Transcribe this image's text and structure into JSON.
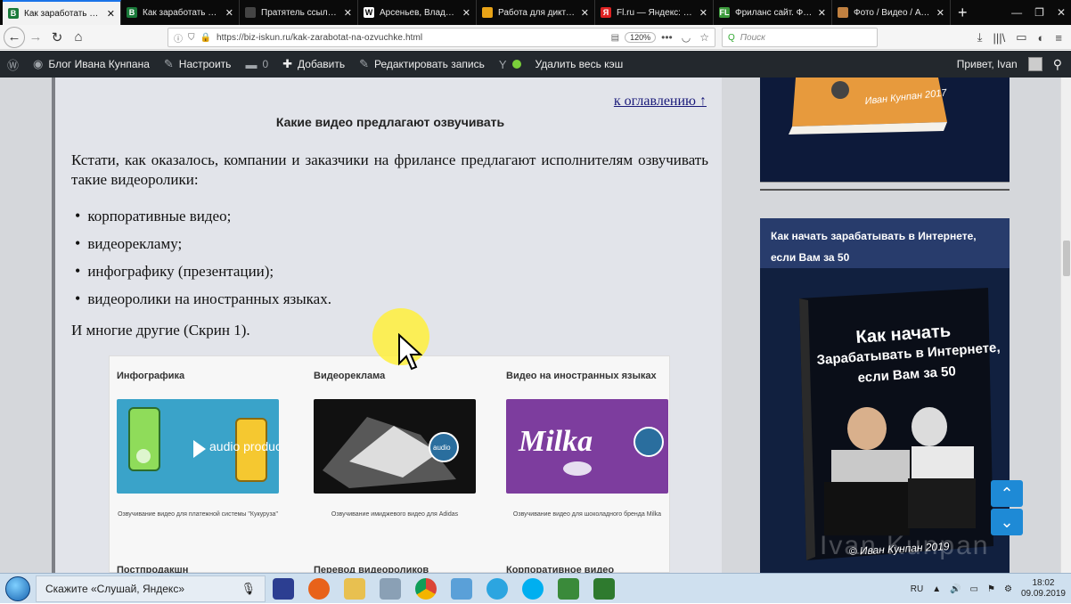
{
  "browser": {
    "tabs": [
      {
        "label": "Как заработать на оз",
        "favicon_color": "#1a7a3a",
        "favicon": "B",
        "active": true
      },
      {
        "label": "Как заработать день",
        "favicon_color": "#1a7a3a",
        "favicon": "B",
        "active": false
      },
      {
        "label": "Пратятель ссылок PRO",
        "favicon_color": "#444",
        "favicon": "",
        "active": false
      },
      {
        "label": "Арсеньев, Владимир",
        "favicon_color": "#fff",
        "favicon": "W",
        "active": false
      },
      {
        "label": "Работа для диктора",
        "favicon_color": "#e8a317",
        "favicon": "",
        "active": false
      },
      {
        "label": "Fl.ru — Яндекс: наш",
        "favicon_color": "#d22",
        "favicon": "Я",
        "active": false
      },
      {
        "label": "Фриланс сайт. Фри",
        "favicon_color": "#3c9a3c",
        "favicon": "FL",
        "active": false
      },
      {
        "label": "Фото / Видео / Ауди",
        "favicon_color": "#c08040",
        "favicon": "",
        "active": false
      }
    ],
    "url": "https://biz-iskun.ru/kak-zarabotat-na-ozvuchke.html",
    "zoom": "120%",
    "search_placeholder": "Поиск"
  },
  "wpbar": {
    "site_name": "Блог Ивана Кунпана",
    "customize": "Настроить",
    "comments": "0",
    "add_new": "Добавить",
    "edit_post": "Редактировать запись",
    "clear_cache": "Удалить весь кэш",
    "greeting": "Привет, Ivan"
  },
  "article": {
    "toc_link": "к оглавлению ↑",
    "heading": "Какие видео предлагают озвучивать",
    "intro": "Кстати, как оказалось, компании и заказчики на фрилансе предлагают исполнителям озвучивать такие видеоролики:",
    "list": [
      "корпоративные видео;",
      "видеорекламу;",
      "инфографику (презентации);",
      "видеоролики на иностранных языках."
    ],
    "outro": "И многие другие (Скрин 1).",
    "screenshot": {
      "cards": [
        {
          "title": "Инфографика",
          "caption": "Озвучивание видео для платежной системы \"Кукуруза\"",
          "bottom_title": "Постпродакшн",
          "thumb_text": "audio production"
        },
        {
          "title": "Видеореклама",
          "caption": "Озвучивание имиджевого видео для Adidas",
          "bottom_title": "Перевод видеороликов",
          "thumb_text": "audio"
        },
        {
          "title": "Видео на иностранных языках",
          "caption": "Озвучивание видео для шоколадного бренда Milka",
          "bottom_title": "Корпоративное видео",
          "thumb_text": "Milka"
        }
      ]
    }
  },
  "sidebar": {
    "book1_author": "Иван Кунпан 2017",
    "widget_title": "Как начать зарабатывать в Интернете, если Вам за 50",
    "book2_title": "Как начать Зарабатывать в Интернете, если Вам за 50",
    "book2_author": "© Иван Кунпан 2019",
    "watermark": "Ivan Kunpan"
  },
  "taskbar": {
    "search_text": "Скажите «Слушай, Яндекс»",
    "lang": "RU",
    "time": "18:02",
    "date": "09.09.2019"
  }
}
